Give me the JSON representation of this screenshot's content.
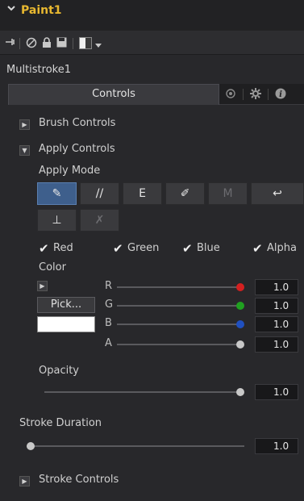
{
  "header": {
    "title": "Paint1",
    "collapse_icon": "chevron-down-icon"
  },
  "toolbar": {
    "icons": [
      "pin-icon",
      "disable-icon",
      "lock-icon",
      "save-icon",
      "color-swatch-icon",
      "dropdown-caret-icon"
    ]
  },
  "node_name": "Multistroke1",
  "tabs": {
    "active_label": "Controls",
    "icons": [
      "modifier-icon",
      "settings-gear-icon",
      "info-icon"
    ]
  },
  "sections": {
    "brush": {
      "label": "Brush Controls",
      "expanded": false
    },
    "apply": {
      "label": "Apply Controls",
      "expanded": true
    },
    "stroke": {
      "label": "Stroke Controls",
      "expanded": false
    }
  },
  "apply_mode": {
    "label": "Apply Mode",
    "buttons": [
      {
        "glyph": "✎",
        "icon": "color-brush-icon",
        "active": true
      },
      {
        "glyph": "//",
        "icon": "clone-icon",
        "active": false
      },
      {
        "glyph": "E",
        "icon": "emboss-icon",
        "active": false
      },
      {
        "glyph": "✐",
        "icon": "erase-icon",
        "active": false
      },
      {
        "glyph": "M",
        "icon": "merge-icon",
        "active": false,
        "dim": true
      },
      {
        "glyph": "↩",
        "icon": "smear-icon",
        "active": false
      },
      {
        "glyph": "⊥",
        "icon": "stamp-icon",
        "active": false
      },
      {
        "glyph": "✗",
        "icon": "wire-icon",
        "active": false,
        "dim": true
      }
    ]
  },
  "channels": {
    "red": "Red",
    "green": "Green",
    "blue": "Blue",
    "alpha": "Alpha"
  },
  "color": {
    "label": "Color",
    "pick_label": "Pick...",
    "swatch": "#ffffff",
    "rows": [
      {
        "channel": "R",
        "value": "1.0",
        "knob": "#d42020"
      },
      {
        "channel": "G",
        "value": "1.0",
        "knob": "#20a020"
      },
      {
        "channel": "B",
        "value": "1.0",
        "knob": "#2050c0"
      },
      {
        "channel": "A",
        "value": "1.0",
        "knob": "#c8c8c8"
      }
    ]
  },
  "opacity": {
    "label": "Opacity",
    "value": "1.0",
    "level": 1.0
  },
  "stroke_duration": {
    "label": "Stroke Duration",
    "value": "1.0",
    "level": 0.0
  },
  "colors": {
    "accent": "#e8b830",
    "active_button": "#3e5f8c"
  }
}
